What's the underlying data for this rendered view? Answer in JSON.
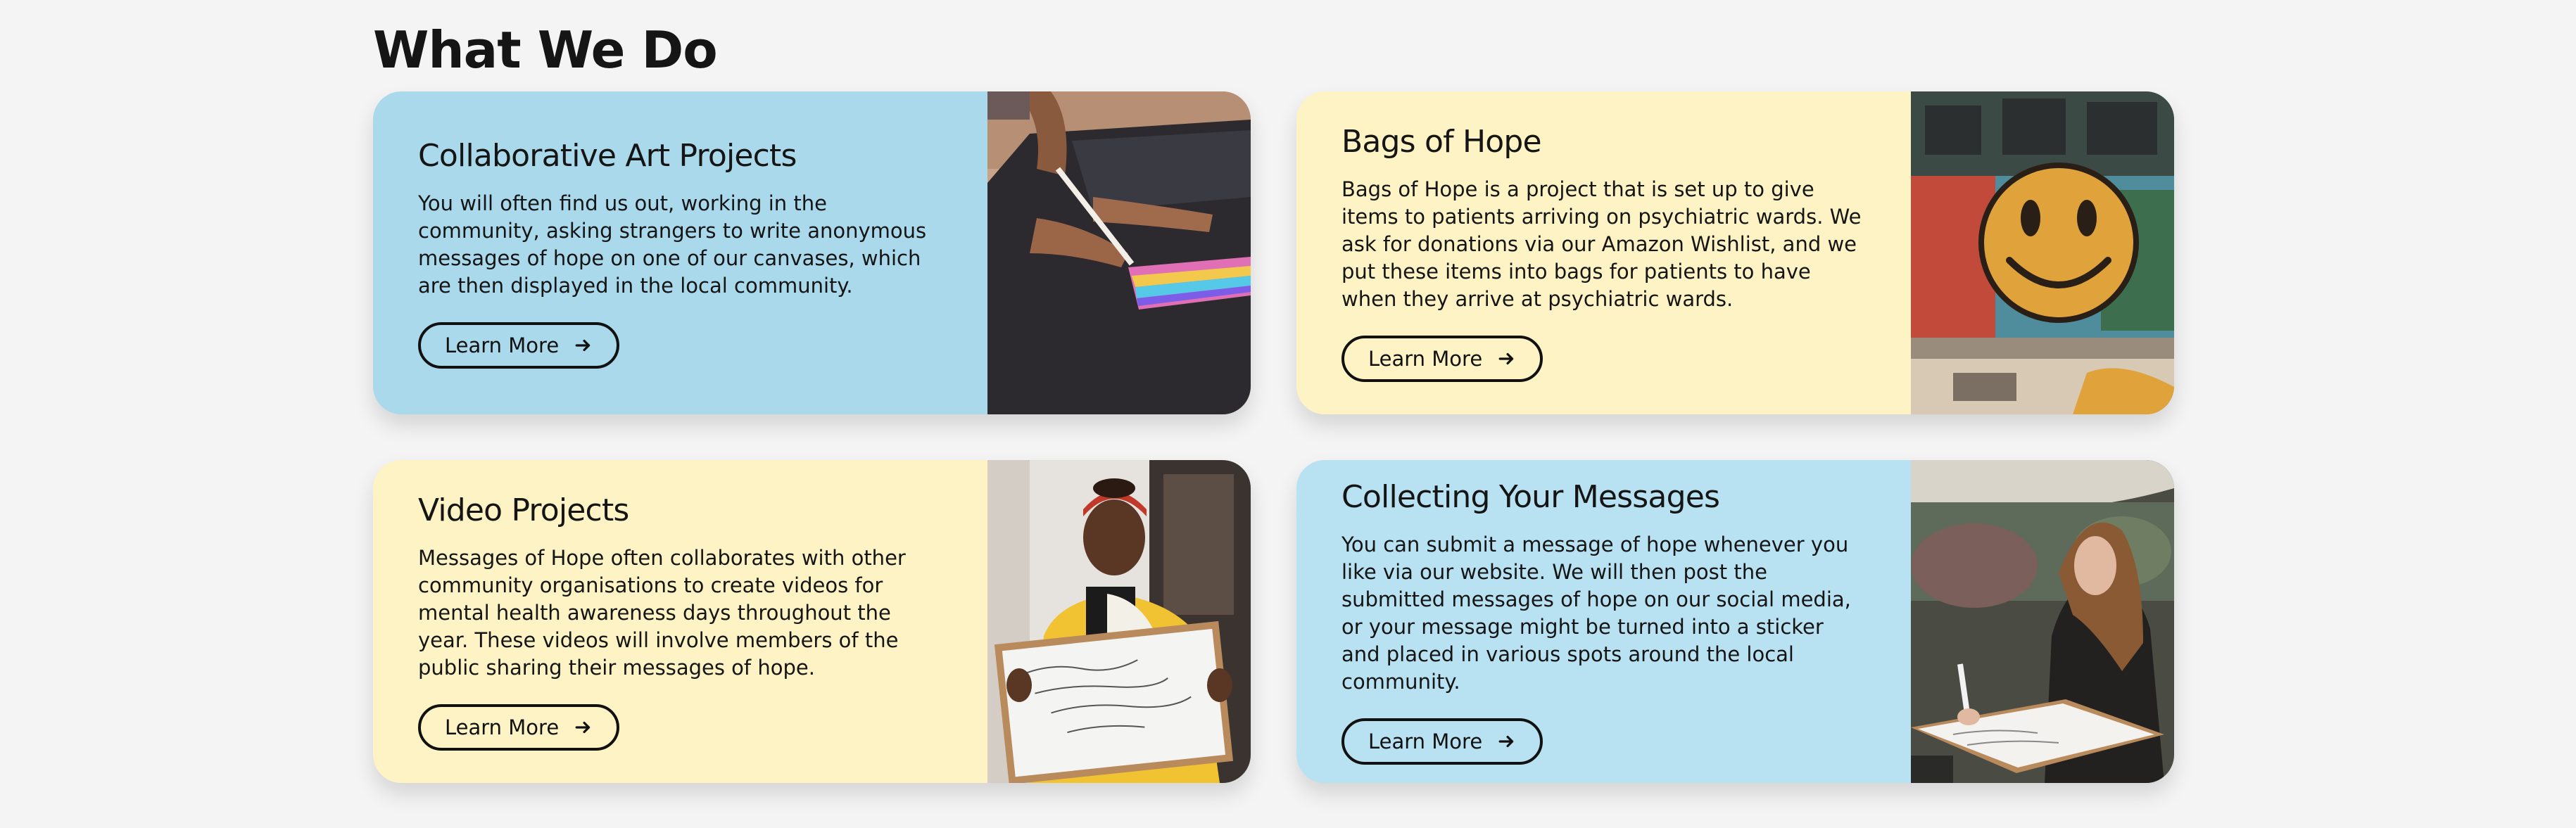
{
  "section": {
    "title": "What We Do"
  },
  "cards": [
    {
      "title": "Collaborative Art Projects",
      "description": "You will often find us out, working in the community, asking strangers to write anonymous messages of hope on one of our canvases, which are then displayed in the local community.",
      "button": "Learn More",
      "bg_color": "#aad9ec"
    },
    {
      "title": "Bags of Hope",
      "description": "Bags of Hope is a project that is set up to give items to patients arriving on psychiatric wards. We ask for donations via our Amazon Wishlist, and we put these items into bags for patients to have when they arrive at psychiatric wards.",
      "button": "Learn More",
      "bg_color": "#fdf3c5"
    },
    {
      "title": "Video Projects",
      "description": "Messages of Hope often collaborates with other community organisations to create videos for mental health awareness days throughout the year. These videos will involve members of the public sharing their messages of hope.",
      "button": "Learn More",
      "bg_color": "#fdf3c5"
    },
    {
      "title": "Collecting Your Messages",
      "description": "You can submit a message of hope whenever you like via our website. We will then post the submitted messages of hope on our social media, or your message might be turned into a sticker and placed in various spots around the local community.",
      "button": "Learn More",
      "bg_color": "#b8e1f1"
    }
  ],
  "icons": {
    "button_arrow": "arrow-right-icon"
  }
}
